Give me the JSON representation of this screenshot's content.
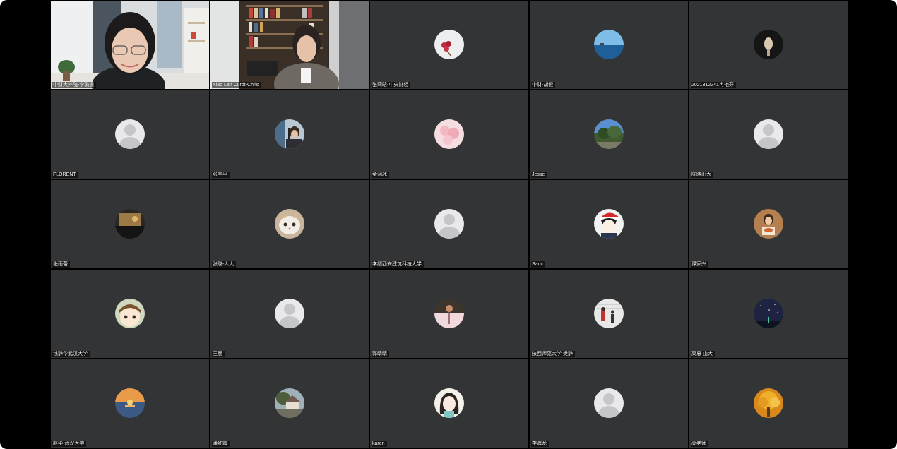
{
  "meeting": {
    "participants": [
      {
        "name": "中财大外院-李璐遥",
        "type": "video"
      },
      {
        "name": "Xiao Lan Curdt-Chris",
        "type": "video"
      },
      {
        "name": "张莉晗-中央财经",
        "type": "photo",
        "icon": "red-flowers-avatar-icon"
      },
      {
        "name": "中财-胡健",
        "type": "photo",
        "icon": "sea-horizon-avatar-icon"
      },
      {
        "name": "2021312241冉艳芬",
        "type": "photo",
        "icon": "dark-hand-avatar-icon"
      },
      {
        "name": "FLORENT",
        "type": "default",
        "icon": "default-user-avatar-icon"
      },
      {
        "name": "张宇平",
        "type": "photo",
        "icon": "person-microphone-avatar-icon"
      },
      {
        "name": "金涵冰",
        "type": "photo",
        "icon": "pink-blossom-avatar-icon"
      },
      {
        "name": "Jesse",
        "type": "photo",
        "icon": "tree-landscape-avatar-icon"
      },
      {
        "name": "陈晓山大",
        "type": "default",
        "icon": "default-user-avatar-icon"
      },
      {
        "name": "张雨蕾",
        "type": "photo",
        "icon": "warm-scene-avatar-icon"
      },
      {
        "name": "张璐-人大",
        "type": "photo",
        "icon": "cat-avatar-icon"
      },
      {
        "name": "李超西安建筑科技大学",
        "type": "default",
        "icon": "default-user-avatar-icon"
      },
      {
        "name": "Sanc",
        "type": "photo",
        "icon": "santa-hat-boy-avatar-icon"
      },
      {
        "name": "谭家兴",
        "type": "photo",
        "icon": "child-food-avatar-icon"
      },
      {
        "name": "钱静华武汉大学",
        "type": "photo",
        "icon": "cartoon-face-avatar-icon"
      },
      {
        "name": "王丽",
        "type": "default",
        "icon": "default-user-avatar-icon"
      },
      {
        "name": "郭晴晴",
        "type": "photo",
        "icon": "dark-pink-flower-avatar-icon"
      },
      {
        "name": "陕西师范大学 樊静",
        "type": "photo",
        "icon": "winter-figures-avatar-icon"
      },
      {
        "name": "高恩 山大",
        "type": "photo",
        "icon": "night-sky-avatar-icon"
      },
      {
        "name": "赵华-武汉大学",
        "type": "photo",
        "icon": "sunset-sea-avatar-icon"
      },
      {
        "name": "潘红霞",
        "type": "photo",
        "icon": "house-landscape-avatar-icon"
      },
      {
        "name": "karen",
        "type": "photo",
        "icon": "anime-girl-avatar-icon"
      },
      {
        "name": "李海龙",
        "type": "default",
        "icon": "default-user-avatar-icon"
      },
      {
        "name": "高老师",
        "type": "photo",
        "icon": "autumn-tree-avatar-icon"
      }
    ]
  },
  "colors": {
    "background": "#000000",
    "tile": "#333436",
    "default_avatar_bg": "#e9e9eb",
    "default_avatar_fg": "#c5c6c9"
  }
}
